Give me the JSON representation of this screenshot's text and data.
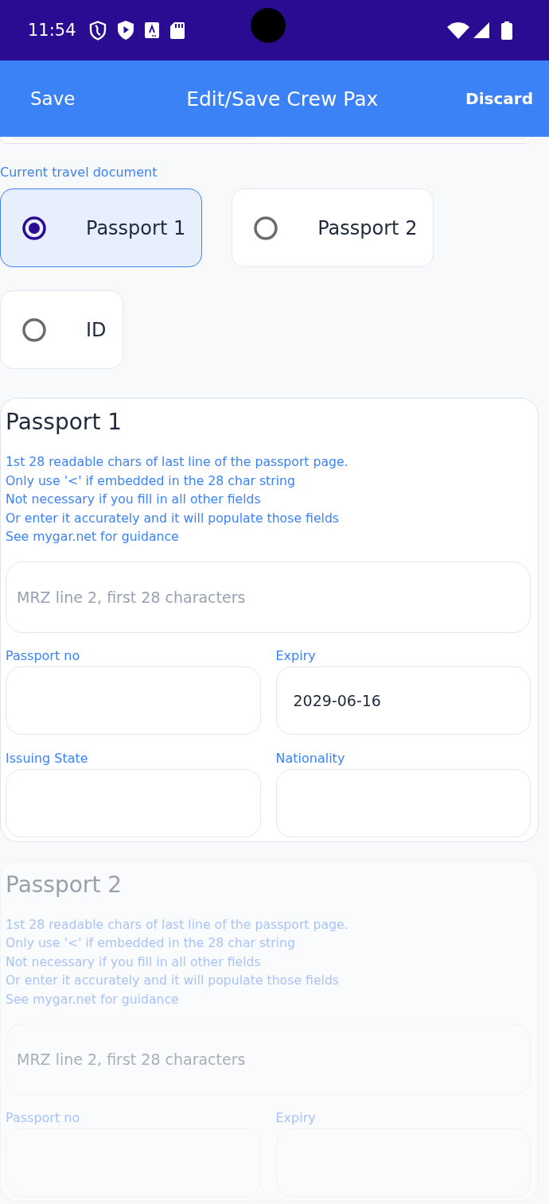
{
  "status_bar": {
    "time": "11:54"
  },
  "app_bar": {
    "left_action": "Save",
    "title": "Edit/Save Crew Pax",
    "right_action": "Discard"
  },
  "travel_document": {
    "label": "Current travel document",
    "options": [
      {
        "label": "Passport 1",
        "selected": true
      },
      {
        "label": "Passport 2",
        "selected": false
      },
      {
        "label": "ID",
        "selected": false
      }
    ]
  },
  "documents": [
    {
      "title": "Passport 1",
      "disabled": false,
      "help": "1st 28 readable chars of last line of the passport page.\nOnly use '<' if embedded in the 28 char string\nNot necessary if you fill in all other fields\nOr enter it accurately and it will populate those fields\nSee mygar.net for guidance",
      "mrz": {
        "placeholder": "MRZ line 2, first 28 characters"
      },
      "fields": [
        {
          "label": "Passport no"
        },
        {
          "label": "Expiry",
          "value": "2029-06-16"
        },
        {
          "label": "Issuing State"
        },
        {
          "label": "Nationality"
        }
      ]
    },
    {
      "title": "Passport 2",
      "disabled": true,
      "help": "1st 28 readable chars of last line of the passport page.\nOnly use '<' if embedded in the 28 char string\nNot necessary if you fill in all other fields\nOr enter it accurately and it will populate those fields\nSee mygar.net for guidance",
      "mrz": {
        "placeholder": "MRZ line 2, first 28 characters"
      },
      "fields": [
        {
          "label": "Passport no"
        },
        {
          "label": "Expiry"
        }
      ]
    }
  ]
}
